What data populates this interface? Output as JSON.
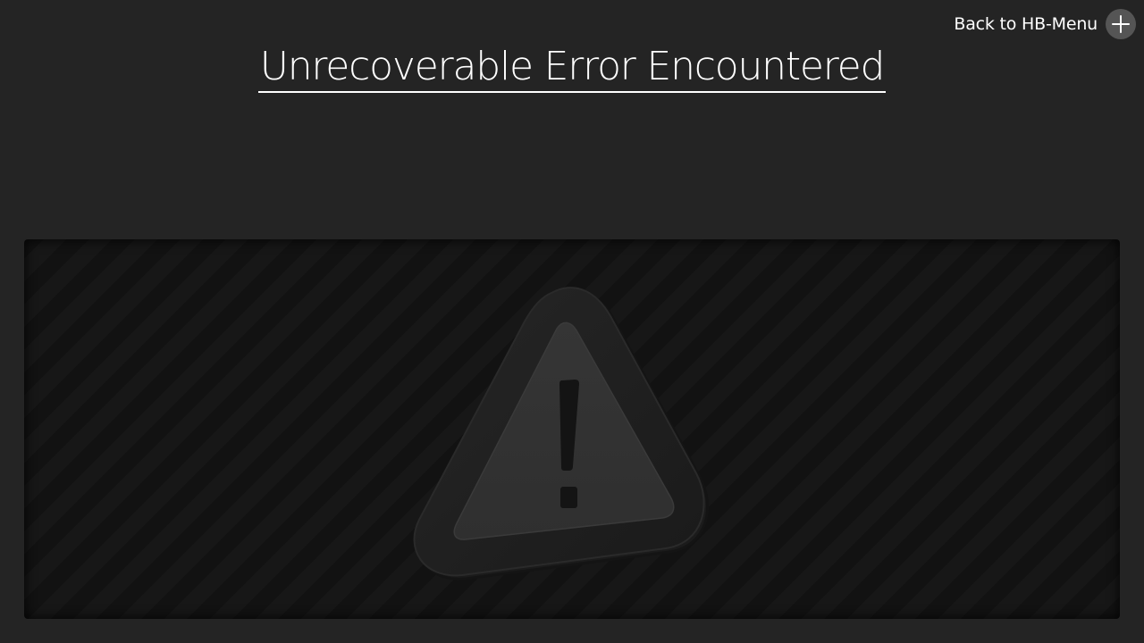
{
  "header": {
    "back_label": "Back to HB-Menu",
    "back_icon": "plus-circle-icon"
  },
  "page": {
    "title": "Unrecoverable Error Encountered"
  },
  "panel": {
    "icon": "warning-triangle-icon"
  },
  "colors": {
    "background": "#242424",
    "panel": "#111111",
    "text": "#ffffff",
    "button_circle": "#555555"
  }
}
